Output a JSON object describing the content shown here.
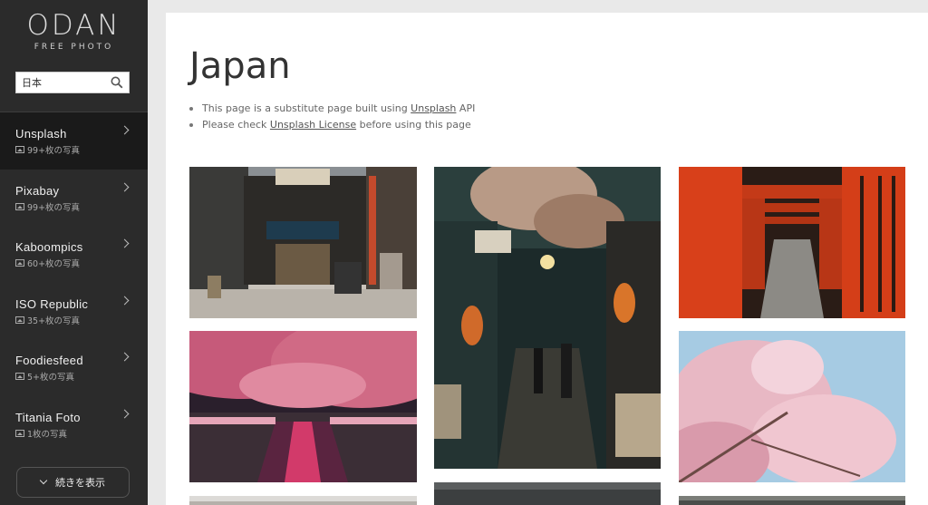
{
  "logo": {
    "main": "ODAN",
    "sub": "FREE PHOTO"
  },
  "search": {
    "value": "日本"
  },
  "nav": [
    {
      "label": "Unsplash",
      "count": "99+枚の写真"
    },
    {
      "label": "Pixabay",
      "count": "99+枚の写真"
    },
    {
      "label": "Kaboompics",
      "count": "60+枚の写真"
    },
    {
      "label": "ISO Republic",
      "count": "35+枚の写真"
    },
    {
      "label": "Foodiesfeed",
      "count": "5+枚の写真"
    },
    {
      "label": "Titania Foto",
      "count": "1枚の写真"
    }
  ],
  "more_button": "続きを表示",
  "page": {
    "title": "Japan",
    "note1_prefix": "This page is a substitute page built using ",
    "note1_link": "Unsplash",
    "note1_suffix": " API",
    "note2_prefix": "Please check ",
    "note2_link": "Unsplash License",
    "note2_suffix": " before using this page"
  }
}
